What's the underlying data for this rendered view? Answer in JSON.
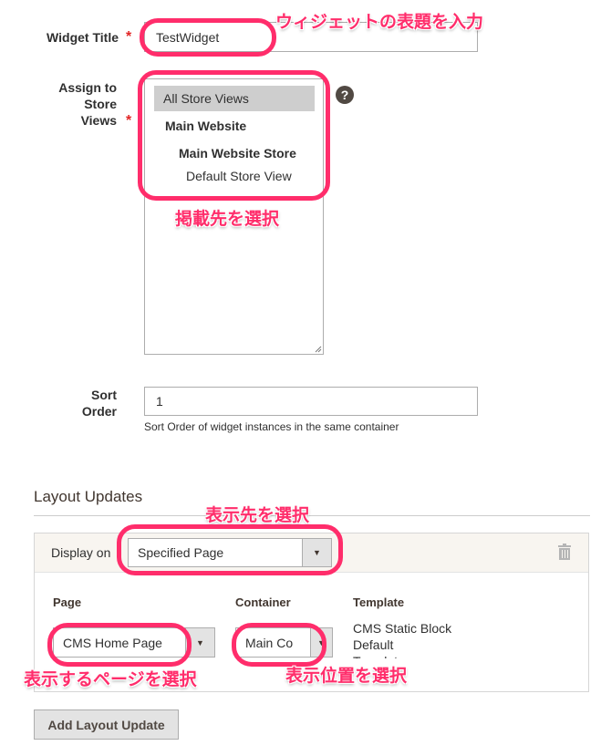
{
  "widget_title": {
    "label": "Widget Title",
    "required_mark": "*",
    "value": "TestWidget"
  },
  "store_views": {
    "label_lines": [
      "Assign to",
      "Store",
      "Views"
    ],
    "required_mark": "*",
    "options": [
      {
        "label": "All Store Views",
        "selected": true,
        "bold": false
      },
      {
        "label": "Main Website",
        "selected": false,
        "bold": true
      },
      {
        "label": "Main Website Store",
        "selected": false,
        "bold": true
      },
      {
        "label": "Default Store View",
        "selected": false,
        "bold": false
      }
    ],
    "help_icon": "question-circle-icon",
    "help_glyph": "?"
  },
  "sort_order": {
    "label_lines": [
      "Sort",
      "Order"
    ],
    "value": "1",
    "note": "Sort Order of widget instances in the same container"
  },
  "layout_updates": {
    "title": "Layout Updates",
    "display_on_label": "Display on",
    "display_on_value": "Specified Page",
    "delete_icon": "trash-icon",
    "columns": {
      "page": "Page",
      "container": "Container",
      "template": "Template"
    },
    "page_value": "CMS Home Page",
    "container_value": "Main Co",
    "template_lines": [
      "CMS Static Block",
      "Default",
      "Template"
    ],
    "add_button": "Add Layout Update"
  },
  "annotations": {
    "title_note": "ウィジェットの表題を入力",
    "store_note": "掲載先を選択",
    "display_note": "表示先を選択",
    "page_note": "表示するページを選択",
    "container_note": "表示位置を選択",
    "color": "#ff2d6b"
  }
}
